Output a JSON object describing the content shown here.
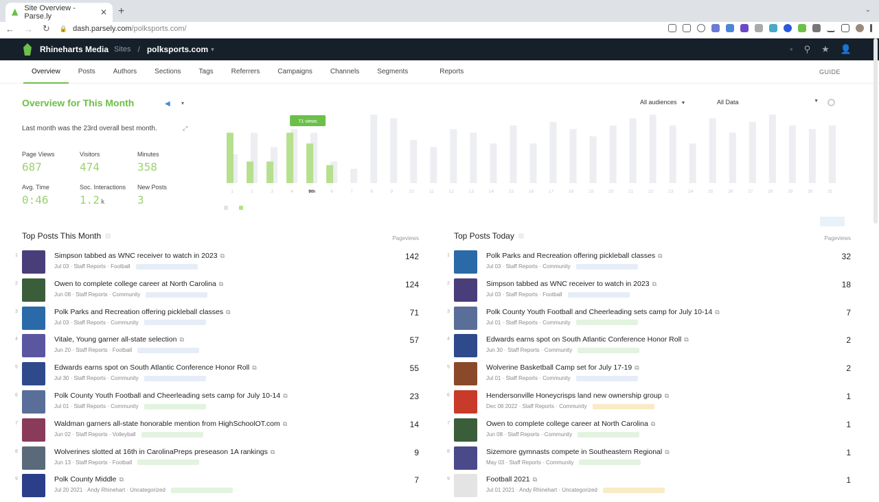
{
  "browser": {
    "tab_title": "Site Overview - Parse.ly",
    "url_domain": "dash.parsely.com",
    "url_path": "/polksports.com/"
  },
  "header": {
    "org": "Rhineharts Media",
    "sites_label": "Sites",
    "separator": "/",
    "site": "polksports.com"
  },
  "nav": {
    "tabs": [
      "Overview",
      "Posts",
      "Authors",
      "Sections",
      "Tags",
      "Referrers",
      "Campaigns",
      "Channels",
      "Segments",
      "Reports"
    ],
    "guide": "GUIDE"
  },
  "overview": {
    "title": "Overview for This Month",
    "best_month": "Last month was the 23rd overall best month.",
    "audience_select": "All audiences",
    "data_select": "All Data",
    "metrics": [
      {
        "label": "Page Views",
        "value": "687",
        "unit": ""
      },
      {
        "label": "Visitors",
        "value": "474",
        "unit": ""
      },
      {
        "label": "Minutes",
        "value": "358",
        "unit": ""
      },
      {
        "label": "Avg. Time",
        "value": "0:46",
        "unit": ""
      },
      {
        "label": "Soc. Interactions",
        "value": "1.2",
        "unit": "k"
      },
      {
        "label": "New Posts",
        "value": "3",
        "unit": ""
      }
    ]
  },
  "chart_data": {
    "type": "bar",
    "highlight_label": "9th",
    "highlight_tooltip": "71 views",
    "categories": [
      "1",
      "2",
      "3",
      "4",
      "5",
      "6",
      "7",
      "8",
      "9",
      "10",
      "11",
      "12",
      "13",
      "14",
      "15",
      "16",
      "17",
      "18",
      "19",
      "20",
      "21",
      "22",
      "23",
      "24",
      "25",
      "26",
      "27",
      "28",
      "29",
      "30",
      "31"
    ],
    "series": [
      {
        "values": [
          40,
          70,
          50,
          75,
          70,
          30,
          20,
          95,
          90,
          60,
          50,
          75,
          70,
          55,
          80,
          55,
          85,
          75,
          65,
          80,
          90,
          95,
          80,
          55,
          90,
          70,
          85,
          95,
          80,
          75,
          80
        ]
      },
      {
        "values": [
          70,
          30,
          30,
          70,
          55,
          25,
          0,
          0,
          0,
          0,
          0,
          0,
          0,
          0,
          0,
          0,
          0,
          0,
          0,
          0,
          0,
          0,
          0,
          0,
          0,
          0,
          0,
          0,
          0,
          0,
          0
        ]
      }
    ],
    "highlight_index": 4,
    "ylim": [
      0,
      100
    ],
    "colors": {
      "previous": "#eceef2",
      "current": "#b6e08d",
      "tooltip": "#6cc04a"
    }
  },
  "top_month": {
    "title": "Top Posts This Month",
    "column": "Pageviews",
    "posts": [
      {
        "rank": "1",
        "title": "Simpson tabbed as WNC receiver to watch in 2023",
        "meta": "Jul 03 · Staff Reports · Football",
        "pv": "142",
        "thumb": "#4a3e7a",
        "tag": "blue"
      },
      {
        "rank": "2",
        "title": "Owen to complete college career at North Carolina",
        "meta": "Jun 08 · Staff Reports · Community",
        "pv": "124",
        "thumb": "#3b5e3a",
        "tag": "blue"
      },
      {
        "rank": "3",
        "title": "Polk Parks and Recreation offering pickleball classes",
        "meta": "Jul 03 · Staff Reports · Community",
        "pv": "71",
        "thumb": "#2a6aa8",
        "tag": "blue"
      },
      {
        "rank": "4",
        "title": "Vitale, Young garner all-state selection",
        "meta": "Jun 20 · Staff Reports · Football",
        "pv": "57",
        "thumb": "#5a56a0",
        "tag": "blue"
      },
      {
        "rank": "5",
        "title": "Edwards earns spot on South Atlantic Conference Honor Roll",
        "meta": "Jul 30 · Staff Reports · Community",
        "pv": "55",
        "thumb": "#2e4a8c",
        "tag": "blue"
      },
      {
        "rank": "6",
        "title": "Polk County Youth Football and Cheerleading sets camp for July 10-14",
        "meta": "Jul 01 · Staff Reports · Community",
        "pv": "23",
        "thumb": "#5a6e9a",
        "tag": "green"
      },
      {
        "rank": "7",
        "title": "Waldman garners all-state honorable mention from HighSchoolOT.com",
        "meta": "Jun 02 · Staff Reports · Volleyball",
        "pv": "14",
        "thumb": "#8a3b5a",
        "tag": "green"
      },
      {
        "rank": "8",
        "title": "Wolverines slotted at 16th in CarolinaPreps preseason 1A rankings",
        "meta": "Jun 13 · Staff Reports · Football",
        "pv": "9",
        "thumb": "#5a6a7a",
        "tag": "green"
      },
      {
        "rank": "9",
        "title": "Polk County Middle",
        "meta": "Jul 20 2021 · Andy Rhinehart · Uncategorized",
        "pv": "7",
        "thumb": "#2a3e8a",
        "tag": "green"
      }
    ]
  },
  "top_today": {
    "title": "Top Posts Today",
    "column": "Pageviews",
    "posts": [
      {
        "rank": "1",
        "title": "Polk Parks and Recreation offering pickleball classes",
        "meta": "Jul 03 · Staff Reports · Community",
        "pv": "32",
        "thumb": "#2a6aa8",
        "tag": "blue"
      },
      {
        "rank": "2",
        "title": "Simpson tabbed as WNC receiver to watch in 2023",
        "meta": "Jul 03 · Staff Reports · Football",
        "pv": "18",
        "thumb": "#4a3e7a",
        "tag": "blue"
      },
      {
        "rank": "3",
        "title": "Polk County Youth Football and Cheerleading sets camp for July 10-14",
        "meta": "Jul 01 · Staff Reports · Community",
        "pv": "7",
        "thumb": "#5a6e9a",
        "tag": "green"
      },
      {
        "rank": "4",
        "title": "Edwards earns spot on South Atlantic Conference Honor Roll",
        "meta": "Jun 30 · Staff Reports · Community",
        "pv": "2",
        "thumb": "#2e4a8c",
        "tag": "green"
      },
      {
        "rank": "5",
        "title": "Wolverine Basketball Camp set for July 17-19",
        "meta": "Jul 01 · Staff Reports · Community",
        "pv": "2",
        "thumb": "#8a4a2a",
        "tag": "blue"
      },
      {
        "rank": "6",
        "title": "Hendersonville Honeycrisps land new ownership group",
        "meta": "Dec 08 2022 · Staff Reports · Community",
        "pv": "1",
        "thumb": "#c83a2a",
        "tag": "yellow"
      },
      {
        "rank": "7",
        "title": "Owen to complete college career at North Carolina",
        "meta": "Jun 08 · Staff Reports · Community",
        "pv": "1",
        "thumb": "#3b5e3a",
        "tag": "green"
      },
      {
        "rank": "8",
        "title": "Sizemore gymnasts compete in Southeastern Regional",
        "meta": "May 03 · Staff Reports · Community",
        "pv": "1",
        "thumb": "#4a4a8a",
        "tag": "green"
      },
      {
        "rank": "9",
        "title": "Football 2021",
        "meta": "Jul 01 2021 · Andy Rhinehart · Uncategorized",
        "pv": "1",
        "thumb": "#e4e4e4",
        "tag": "yellow"
      }
    ]
  }
}
